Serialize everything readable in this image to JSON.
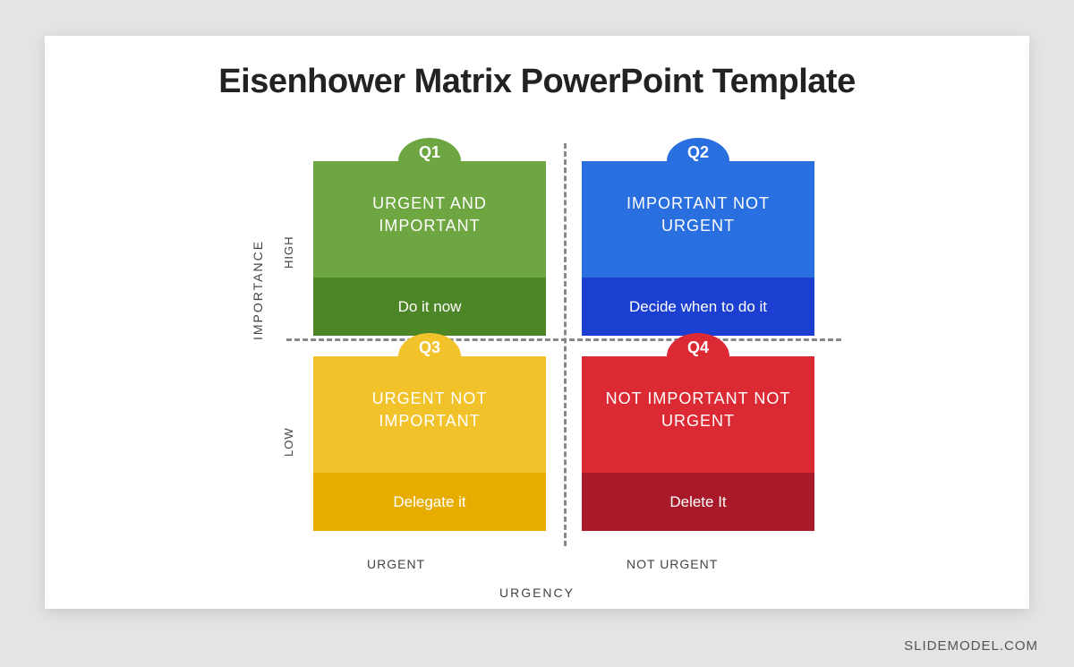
{
  "title": "Eisenhower Matrix PowerPoint Template",
  "axes": {
    "y": "IMPORTANCE",
    "yhigh": "HIGH",
    "ylow": "LOW",
    "x": "URGENCY",
    "xleft": "URGENT",
    "xright": "NOT URGENT"
  },
  "quadrants": {
    "q1": {
      "label": "Q1",
      "heading": "URGENT AND IMPORTANT",
      "action": "Do it now"
    },
    "q2": {
      "label": "Q2",
      "heading": "IMPORTANT NOT URGENT",
      "action": "Decide when to do it"
    },
    "q3": {
      "label": "Q3",
      "heading": "URGENT NOT IMPORTANT",
      "action": "Delegate it"
    },
    "q4": {
      "label": "Q4",
      "heading": "NOT IMPORTANT NOT URGENT",
      "action": "Delete It"
    }
  },
  "brand": "SLIDEMODEL.COM",
  "colors": {
    "q1": {
      "main": "#6ea641",
      "dark": "#4c8626"
    },
    "q2": {
      "main": "#2a6fe0",
      "dark": "#1b3fd0"
    },
    "q3": {
      "main": "#f2c22b",
      "dark": "#e6ac00"
    },
    "q4": {
      "main": "#db2a33",
      "dark": "#a8192a"
    }
  }
}
